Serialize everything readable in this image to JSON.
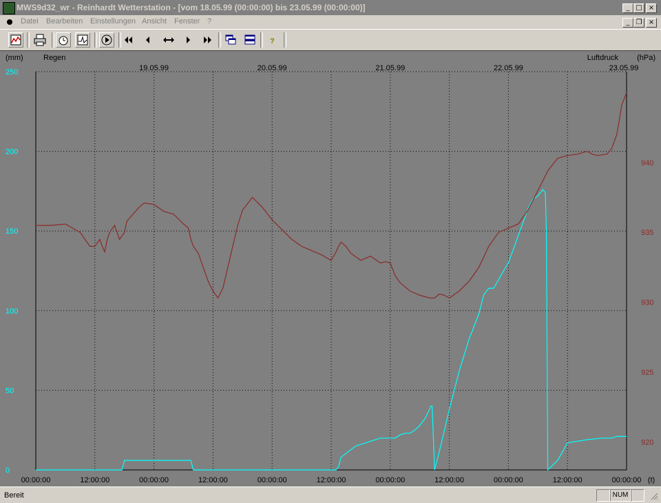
{
  "window": {
    "title": "MWS9d32_wr - Reinhardt Wetterstation - [vom 18.05.99 (00:00:00) bis 23.05.99 (00:00:00)]",
    "controls": {
      "minimize": "_",
      "maximize": "□",
      "close": "×",
      "restore": "❐"
    }
  },
  "menu": [
    "Datei",
    "Bearbeiten",
    "Einstellungen",
    "Ansicht",
    "Fenster",
    "?"
  ],
  "toolbar": {
    "buttons": [
      "chart-icon",
      "print-icon",
      "clock-icon",
      "curve-icon",
      "play-icon",
      "first-icon",
      "prev-icon",
      "zoom-icon",
      "next-icon",
      "last-icon",
      "cascade-icon",
      "tile-icon",
      "help-icon"
    ]
  },
  "status": {
    "text": "Bereit",
    "num": "NUM"
  },
  "colors": {
    "rain": "#00ffff",
    "pressure": "#8b2a2a",
    "grid": "#000000",
    "background": "#808080"
  },
  "chart_data": {
    "type": "line",
    "left_axis": {
      "unit": "(mm)",
      "label": "Regen",
      "ticks": [
        "0",
        "50",
        "100",
        "150",
        "200",
        "250"
      ],
      "range": [
        0,
        250
      ]
    },
    "right_axis": {
      "unit": "(hPa)",
      "label": "Luftdruck",
      "ticks": [
        "920",
        "925",
        "930",
        "935",
        "940"
      ],
      "range": [
        918,
        946.5
      ]
    },
    "date_labels": [
      "19.05.99",
      "20.05.99",
      "21.05.99",
      "22.05.99",
      "23.05.99"
    ],
    "time_labels": [
      "00:00:00",
      "12:00:00",
      "00:00:00",
      "12:00:00",
      "00:00:00",
      "12:00:00",
      "00:00:00",
      "12:00:00",
      "00:00:00",
      "12:00:00",
      "00:00:00"
    ],
    "x_unit": "(t)",
    "x_range_hours": [
      0,
      120
    ],
    "series": [
      {
        "name": "Regen",
        "axis": "left",
        "x": [
          0,
          17.5,
          18,
          31.5,
          32,
          61,
          61.5,
          62,
          65,
          68,
          69,
          70,
          71,
          72,
          73,
          74,
          75,
          76,
          77,
          78,
          79,
          80,
          80.2,
          80.5,
          81,
          82,
          84,
          86,
          88,
          90,
          91,
          92,
          93,
          95,
          96,
          98,
          100,
          101,
          102,
          103,
          103.5,
          103.7,
          104,
          106,
          108,
          112,
          115,
          117,
          118,
          120
        ],
        "y": [
          0,
          0,
          6,
          6,
          0,
          0,
          2,
          8,
          15,
          18,
          19,
          20,
          20,
          20,
          20,
          22,
          23,
          23,
          25,
          28,
          32,
          38,
          40,
          40,
          0,
          12,
          38,
          62,
          82,
          98,
          110,
          114,
          114,
          125,
          130,
          147,
          164,
          170,
          172,
          176,
          174,
          150,
          0,
          6,
          17,
          19,
          20,
          20,
          21,
          21
        ]
      },
      {
        "name": "Luftdruck",
        "axis": "right",
        "x": [
          0,
          3,
          6,
          9,
          10,
          11,
          12,
          13,
          13.5,
          14,
          14.5,
          15,
          16,
          17,
          18,
          18.5,
          19,
          20,
          21,
          22,
          24,
          26,
          28,
          30,
          31,
          31.5,
          32,
          33,
          34,
          35,
          36,
          37,
          38,
          39,
          40,
          41,
          42,
          44,
          46,
          48,
          50,
          52,
          54,
          56,
          58,
          60,
          61,
          61.5,
          62,
          63,
          64,
          66,
          68,
          70,
          71,
          72,
          73,
          74,
          76,
          78,
          79,
          80,
          81,
          82,
          83,
          84,
          86,
          88,
          90,
          92,
          94,
          96,
          98,
          100,
          102,
          104,
          106,
          108,
          110,
          111,
          112,
          113,
          114,
          116,
          117,
          118,
          118.5,
          119,
          120
        ],
        "y": [
          935.5,
          935.5,
          935.6,
          935,
          934.5,
          934.0,
          934.0,
          934.5,
          934.0,
          933.6,
          934.5,
          935.0,
          935.5,
          934.5,
          935.0,
          935.8,
          936.0,
          936.4,
          936.8,
          937.1,
          937.0,
          936.5,
          936.3,
          935.6,
          935.3,
          934.5,
          934.0,
          933.5,
          932.5,
          931.5,
          930.8,
          930.3,
          931.0,
          932.5,
          934.0,
          935.5,
          936.6,
          937.5,
          936.8,
          935.9,
          935.2,
          934.5,
          934.0,
          933.7,
          933.4,
          933.0,
          933.6,
          934.0,
          934.3,
          934.0,
          933.5,
          933.0,
          933.3,
          932.8,
          932.9,
          932.8,
          931.9,
          931.4,
          930.8,
          930.5,
          930.4,
          930.3,
          930.3,
          930.6,
          930.5,
          930.3,
          930.8,
          931.5,
          932.5,
          934.0,
          935.0,
          935.3,
          935.6,
          936.6,
          938.0,
          939.4,
          940.3,
          940.5,
          940.6,
          940.7,
          940.8,
          940.6,
          940.5,
          940.6,
          941.0,
          942.0,
          943.0,
          944.1,
          945.0
        ]
      }
    ]
  }
}
